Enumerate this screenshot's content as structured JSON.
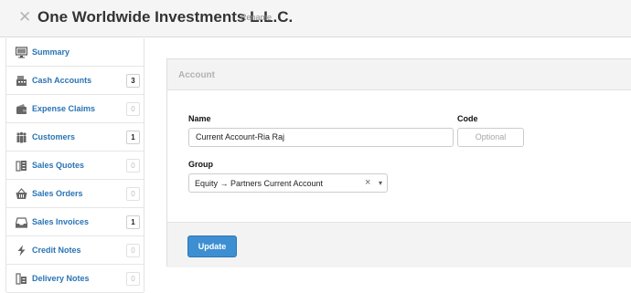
{
  "header": {
    "company_name": "One Worldwide Investments L.L.C.",
    "rename_label": "Rename"
  },
  "sidebar": {
    "items": [
      {
        "label": "Summary",
        "icon": "monitor-icon",
        "badge": ""
      },
      {
        "label": "Cash Accounts",
        "icon": "cash-register-icon",
        "badge": "3"
      },
      {
        "label": "Expense Claims",
        "icon": "wallet-icon",
        "badge": "0"
      },
      {
        "label": "Customers",
        "icon": "customers-icon",
        "badge": "1"
      },
      {
        "label": "Sales Quotes",
        "icon": "sales-quotes-icon",
        "badge": "0"
      },
      {
        "label": "Sales Orders",
        "icon": "basket-icon",
        "badge": "0"
      },
      {
        "label": "Sales Invoices",
        "icon": "inbox-icon",
        "badge": "1"
      },
      {
        "label": "Credit Notes",
        "icon": "lightning-icon",
        "badge": "0"
      },
      {
        "label": "Delivery Notes",
        "icon": "delivery-notes-icon",
        "badge": "0"
      }
    ]
  },
  "form": {
    "panel_title": "Account",
    "name_label": "Name",
    "name_value": "Current Account-Ria Raj",
    "code_label": "Code",
    "code_placeholder": "Optional",
    "group_label": "Group",
    "group_value": "Equity → Partners Current Account",
    "clear_symbol": "×",
    "caret_symbol": "▾",
    "update_label": "Update"
  },
  "colors": {
    "link": "#2874b5",
    "button": "#3d8fd2",
    "header_bg": "#f5f5f5"
  }
}
